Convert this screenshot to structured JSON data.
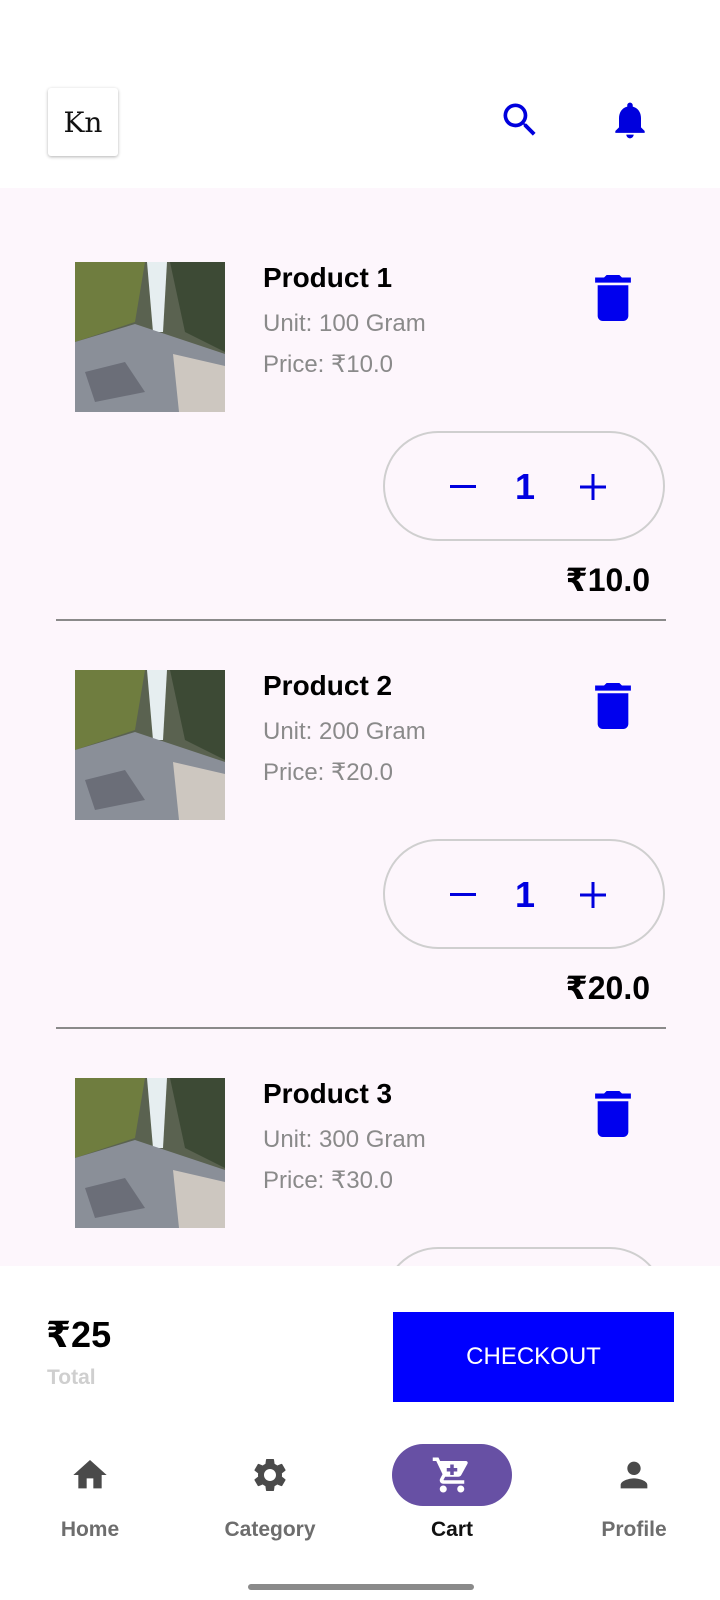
{
  "header": {
    "logo_text": "Kn",
    "search_icon": "search-icon",
    "notification_icon": "bell-icon"
  },
  "cart": {
    "items": [
      {
        "name": "Product 1",
        "unit": "Unit: 100 Gram",
        "price": "Price: ₹10.0",
        "quantity": "1",
        "subtotal": "₹10.0"
      },
      {
        "name": "Product 2",
        "unit": "Unit: 200 Gram",
        "price": "Price: ₹20.0",
        "quantity": "1",
        "subtotal": "₹20.0"
      },
      {
        "name": "Product 3",
        "unit": "Unit: 300 Gram",
        "price": "Price: ₹30.0",
        "quantity": "",
        "subtotal": ""
      }
    ]
  },
  "checkout": {
    "total_amount": "₹25",
    "total_label": "Total",
    "button_label": "CHECKOUT"
  },
  "nav": {
    "items": [
      {
        "label": "Home",
        "icon": "home-icon"
      },
      {
        "label": "Category",
        "icon": "gear-icon"
      },
      {
        "label": "Cart",
        "icon": "cart-icon"
      },
      {
        "label": "Profile",
        "icon": "person-icon"
      }
    ],
    "active": "Cart"
  },
  "colors": {
    "accent": "#0000ff",
    "list_background": "#fdf6fc",
    "nav_active_pill": "#6750a4"
  }
}
